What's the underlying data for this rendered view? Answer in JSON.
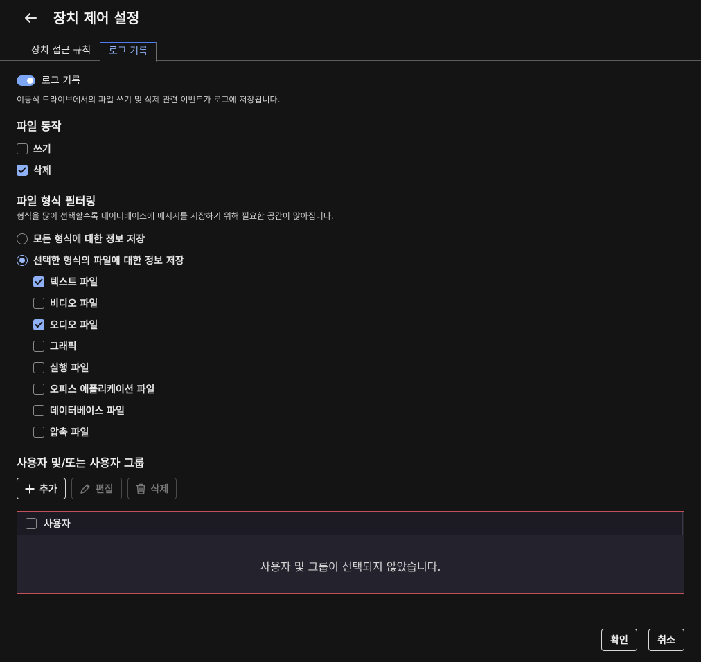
{
  "header": {
    "title": "장치 제어 설정"
  },
  "tabs": [
    {
      "label": "장치 접근 규칙",
      "active": false
    },
    {
      "label": "로그 기록",
      "active": true
    }
  ],
  "logging": {
    "toggle_label": "로그 기록",
    "enabled": true,
    "description": "이동식 드라이브에서의 파일 쓰기 및 삭제 관련 이벤트가 로그에 저장됩니다."
  },
  "file_actions": {
    "title": "파일 동작",
    "items": [
      {
        "label": "쓰기",
        "checked": false
      },
      {
        "label": "삭제",
        "checked": true
      }
    ]
  },
  "filter": {
    "title": "파일 형식 필터링",
    "description": "형식을 많이 선택할수록 데이터베이스에 메시지를 저장하기 위해 필요한 공간이 많아집니다.",
    "radios": [
      {
        "label": "모든 형식에 대한 정보 저장",
        "selected": false
      },
      {
        "label": "선택한 형식의 파일에 대한 정보 저장",
        "selected": true
      }
    ],
    "types": [
      {
        "label": "텍스트 파일",
        "checked": true
      },
      {
        "label": "비디오 파일",
        "checked": false
      },
      {
        "label": "오디오 파일",
        "checked": true
      },
      {
        "label": "그래픽",
        "checked": false
      },
      {
        "label": "실행 파일",
        "checked": false
      },
      {
        "label": "오피스 애플리케이션 파일",
        "checked": false
      },
      {
        "label": "데이터베이스 파일",
        "checked": false
      },
      {
        "label": "압축 파일",
        "checked": false
      }
    ]
  },
  "users": {
    "title": "사용자 및/또는 사용자 그룹",
    "buttons": {
      "add": "추가",
      "edit": "편집",
      "delete": "삭제"
    },
    "table": {
      "column": "사용자",
      "empty": "사용자 및 그룹이 선택되지 않았습니다."
    }
  },
  "footer": {
    "ok": "확인",
    "cancel": "취소"
  },
  "colors": {
    "accent": "#8fb0f5",
    "error_border": "#c2505a",
    "background": "#141414"
  }
}
